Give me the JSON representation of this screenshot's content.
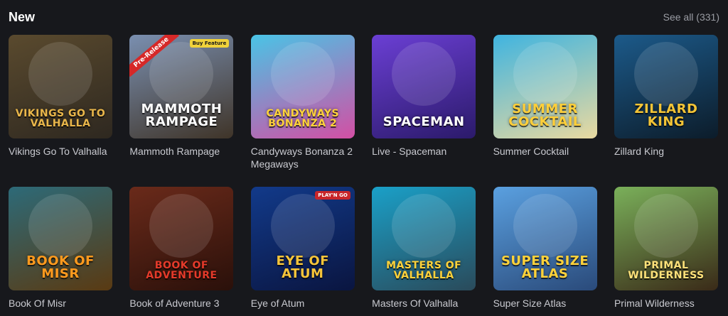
{
  "section": {
    "title": "New",
    "see_all": "See all (331)"
  },
  "games": [
    {
      "name": "Vikings Go To Valhalla",
      "logo": "VIKINGS GO TO VALHALLA",
      "bg": "#5a4a2e",
      "bg2": "#2e2820",
      "logo_color": "#e9b64a"
    },
    {
      "name": "Mammoth Rampage",
      "logo": "MAMMOTH RAMPAGE",
      "bg": "#7a8fb0",
      "bg2": "#3f3428",
      "logo_color": "#ffffff",
      "ribbon": "Pre-Release",
      "tag": "Buy Feature"
    },
    {
      "name": "Candyways Bonanza 2 Megaways",
      "logo": "CANDYWAYS BONANZA 2",
      "bg": "#49c4e6",
      "bg2": "#d34fa4",
      "logo_color": "#ffd23a"
    },
    {
      "name": "Live - Spaceman",
      "logo": "SPACEMAN",
      "bg": "#6b3fd4",
      "bg2": "#2b1a6a",
      "logo_color": "#ffffff"
    },
    {
      "name": "Summer Cocktail",
      "logo": "SUMMER COCKTAIL",
      "bg": "#3fb4e0",
      "bg2": "#e9d9a0",
      "logo_color": "#ffcf3a"
    },
    {
      "name": "Zillard King",
      "logo": "ZILLARD KING",
      "bg": "#1c5a8a",
      "bg2": "#0c1c2a",
      "logo_color": "#f3c436"
    },
    {
      "name": "Book Of Misr",
      "logo": "BOOK OF MISR",
      "bg": "#2d6a78",
      "bg2": "#5a3a12",
      "logo_color": "#ff9a1e"
    },
    {
      "name": "Book of Adventure 3",
      "logo": "BOOK OF ADVENTURE",
      "bg": "#6a2a1a",
      "bg2": "#2a100a",
      "logo_color": "#e53a2a"
    },
    {
      "name": "Eye of Atum",
      "logo": "EYE OF ATUM",
      "bg": "#123a8a",
      "bg2": "#0a1540",
      "logo_color": "#f5c43a",
      "tag": "PLAY'N GO"
    },
    {
      "name": "Masters Of Valhalla",
      "logo": "MASTERS OF VALHALLA",
      "bg": "#1aa0c8",
      "bg2": "#2a4a5a",
      "logo_color": "#ffd23a"
    },
    {
      "name": "Super Size Atlas",
      "logo": "SUPER SIZE ATLAS",
      "bg": "#5aa0e0",
      "bg2": "#2a4a7a",
      "logo_color": "#ffd23a"
    },
    {
      "name": "Primal Wilderness",
      "logo": "PRIMAL WILDERNESS",
      "bg": "#7ab05a",
      "bg2": "#3a2a18",
      "logo_color": "#ffe27a"
    }
  ]
}
